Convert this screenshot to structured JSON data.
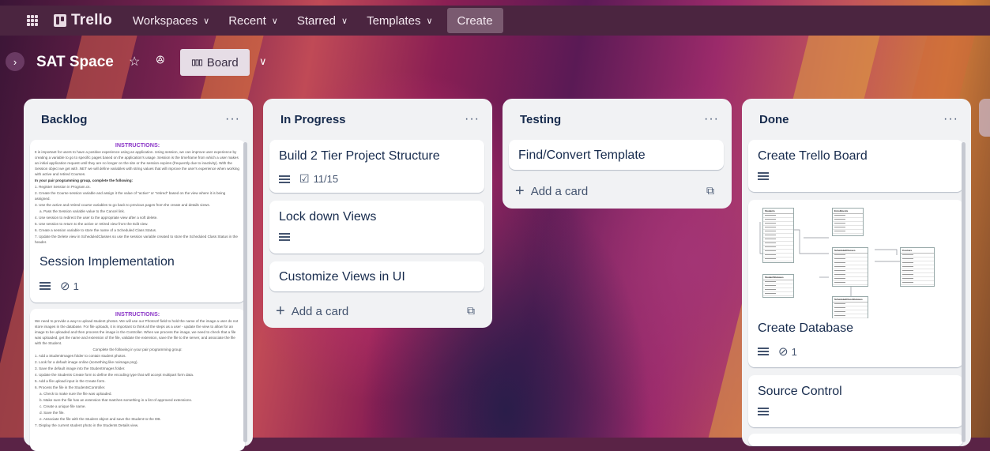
{
  "topbar": {
    "logo": "Trello",
    "nav": [
      {
        "label": "Workspaces",
        "chevron": "∨"
      },
      {
        "label": "Recent",
        "chevron": "∨"
      },
      {
        "label": "Starred",
        "chevron": "∨"
      },
      {
        "label": "Templates",
        "chevron": "∨"
      }
    ],
    "create_label": "Create"
  },
  "board": {
    "title": "SAT Space",
    "view_label": "Board"
  },
  "lists": [
    {
      "title": "Backlog",
      "cards": [
        {
          "cover_heading": "INSTRUCTIONS:",
          "cover_paragraphs": [
            "It is important for users to have a positive experience using an application. Using session, we can improve user experience by creating a variable to go to specific pages based on the application's usage. Session is the timeframe from which a user makes an initial application request until they are no longer on the site or the session expires (frequently due to inactivity). With the Session object we get with .NET we will define variables with string values that will improve the user's experience when working with active and retired Courses.",
            "In your pair programming group, complete the following:",
            "1. Register Session in Program.cs.",
            "2. Create the Course session variable and assign it the value of \"active\" or \"retired\" based on the view where it is being assigned.",
            "3. Use the active and retired course variables to go back to previous pages from the create and details views.",
            "a. Pass the Session variable value to the Cancel link.",
            "4. Use session to redirect the user to the appropriate view after a soft delete.",
            "5. Use session to return to the active or retired view from the Edit view.",
            "6. Create a session variable to store the name of a Scheduled Class Status.",
            "7. Update the Delete view in ScheduledClasses so use the session variable created to store the Scheduled Class Status in the header."
          ],
          "title": "Session Implementation",
          "attachments": "1"
        },
        {
          "cover_heading": "INSTRUCTIONS:",
          "cover_paragraphs": [
            "We need to provide a way to upload student photos. We will use our PhotoUrl field to hold the name of the image a user do not store images in the database. For file uploads, it is important to think all the steps as a user - update the view to allow for an image to be uploaded and then process the image in the Controller. When we process the image, we need to check that a file was uploaded, get the name and extension of the file, validate the extension, save the file to the server, and associate the file with the Student.",
            "Complete the following in your pair programming group:",
            "1. Add a StudentImages folder to contain student photos.",
            "2. Look for a default image online (something like noimage.png).",
            "3. Save the default image into the StudentImages folder.",
            "4. Update the Students Create form to define the encoding type that will accept multipart form data.",
            "5. Add a file upload input in the Create form.",
            "6. Process the file in the StudentsController.",
            "a. Check to make sure the file was uploaded.",
            "b. Make sure the file has an extension that matches something in a list of approved extensions.",
            "c. Create a unique file name.",
            "d. Save the file.",
            "e. Associate the file with the Student object and save the Student to the DB.",
            "7. Display the current student photo in the Students Details view."
          ]
        }
      ]
    },
    {
      "title": "In Progress",
      "cards": [
        {
          "title": "Build 2 Tier Project Structure",
          "checklist": "11/15"
        },
        {
          "title": "Lock down Views"
        },
        {
          "title": "Customize Views in UI"
        }
      ],
      "add_label": "Add a card"
    },
    {
      "title": "Testing",
      "cards": [
        {
          "title": "Find/Convert Template"
        }
      ],
      "add_label": "Add a card"
    },
    {
      "title": "Done",
      "cards": [
        {
          "title": "Create Trello Board"
        },
        {
          "cover_tables": [
            "Students",
            "Enrollments",
            "ScheduledClasses",
            "Courses",
            "StudentStatuses",
            "ScheduledClassStatuses"
          ],
          "title": "Create Database",
          "attachments": "1"
        },
        {
          "title": "Source Control"
        }
      ]
    }
  ]
}
